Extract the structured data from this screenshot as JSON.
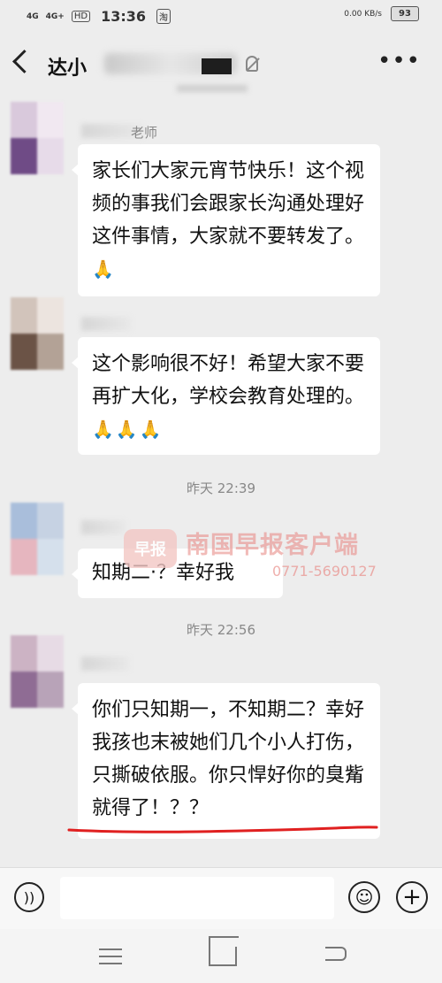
{
  "status_bar": {
    "signal_1": "4G",
    "signal_2": "4G+",
    "hd": "HD",
    "time": "13:36",
    "app_icons": "淘",
    "speed": "0.00 KB/s",
    "battery": "93"
  },
  "header": {
    "title": "达小"
  },
  "messages": [
    {
      "sender": "老师",
      "text": "家长们大家元宵节快乐！这个视频的事我们会跟家长沟通处理好这件事情，大家就不要转发了。",
      "emoji": "🙏"
    },
    {
      "sender": "",
      "text": "这个影响很不好！希望大家不要再扩大化，学校会教育处理的。",
      "emoji": "🙏🙏🙏"
    },
    {
      "sender": "",
      "text": "知期二·？幸好我"
    },
    {
      "sender": "",
      "text": "你们只知期一，不知期二？幸好我孩也末被她们几个小人打伤，只撕破依服。你只悍好你的臭觜就得了！？？"
    }
  ],
  "timestamps": [
    "昨天 22:39",
    "昨天 22:56"
  ],
  "watermark": {
    "logo": "早报",
    "title": "南国早报客户端",
    "phone": "0771-5690127"
  },
  "colors": {
    "background": "#ededed",
    "bubble": "#ffffff",
    "underline": "#e02020"
  }
}
